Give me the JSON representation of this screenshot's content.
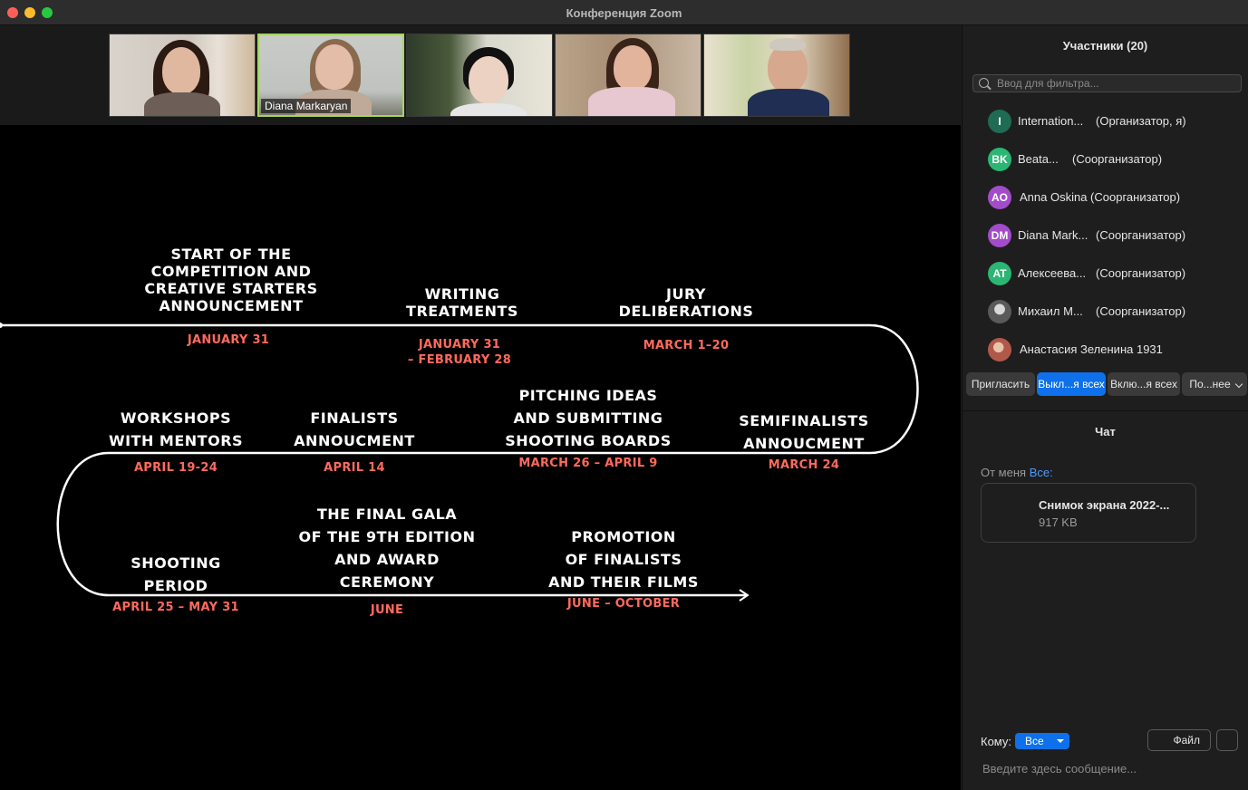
{
  "window": {
    "title": "Конференция Zoom"
  },
  "videos": [
    {
      "name": ""
    },
    {
      "name": "Diana Markaryan"
    },
    {
      "name": ""
    },
    {
      "name": ""
    },
    {
      "name": ""
    }
  ],
  "slide": {
    "milestones": [
      {
        "title": "START OF THE\nCOMPETITION AND\nCREATIVE STARTERS\nANNOUNCEMENT",
        "date": "JANUARY 31"
      },
      {
        "title": "WRITING\nTREATMENTS",
        "date": "JANUARY 31\n– FEBRUARY 28"
      },
      {
        "title": "JURY\nDELIBERATIONS",
        "date": "MARCH 1–20"
      },
      {
        "title": "SEMIFINALISTS\nANNOUCMENT",
        "date": "MARCH 24"
      },
      {
        "title": "PITCHING IDEAS\nAND SUBMITTING\nSHOOTING BOARDS",
        "date": "MARCH 26 – APRIL 9"
      },
      {
        "title": "FINALISTS\nANNOUCMENT",
        "date": "APRIL 14"
      },
      {
        "title": "WORKSHOPS\nWITH MENTORS",
        "date": "APRIL 19-24"
      },
      {
        "title": "SHOOTING\nPERIOD",
        "date": "APRIL 25 – MAY 31"
      },
      {
        "title": "THE FINAL GALA\nOF THE 9TH EDITION\nAND AWARD\nCEREMONY",
        "date": "JUNE"
      },
      {
        "title": "PROMOTION\nOF FINALISTS\nAND THEIR FILMS",
        "date": "JUNE – OCTOBER"
      }
    ]
  },
  "participants": {
    "title": "Участники (20)",
    "filter_placeholder": "Ввод для фильтра...",
    "list": [
      {
        "initials": "I",
        "name": "Internation...",
        "role": "(Организатор, я)",
        "color": "#1f6b54"
      },
      {
        "initials": "BK",
        "name": "Beata...",
        "role": "(Соорганизатор)",
        "color": "#2bb673"
      },
      {
        "initials": "AO",
        "name": "Anna Oskina (Соорганизатор)",
        "role": "",
        "color": "#a34cc9"
      },
      {
        "initials": "DM",
        "name": "Diana Mark...",
        "role": "(Соорганизатор)",
        "color": "#a34cc9"
      },
      {
        "initials": "AT",
        "name": "Алексеева...",
        "role": "(Соорганизатор)",
        "color": "#2bb673"
      },
      {
        "initials": "",
        "name": "Михаил М...",
        "role": "(Соорганизатор)",
        "color": "#6b6b6b"
      },
      {
        "initials": "",
        "name": "Анастасия Зеленина 1931",
        "role": "",
        "color": "#b0584a"
      }
    ],
    "buttons": {
      "invite": "Пригласить",
      "mute_all": "Выкл...я всех",
      "unmute_all": "Вклю...я всех",
      "more": "По...нее"
    }
  },
  "chat": {
    "title": "Чат",
    "from_label": "От меня",
    "to_label_inline": "Все:",
    "file": {
      "name": "Снимок экрана 2022-...",
      "size": "917 KB"
    },
    "to_label": "Кому:",
    "to_value": "Все",
    "file_button": "Файл",
    "input_placeholder": "Введите здесь сообщение..."
  },
  "colors": {
    "accent": "#0e71eb",
    "date_color": "#ff6a5c",
    "active_speaker": "#a4d65e"
  }
}
